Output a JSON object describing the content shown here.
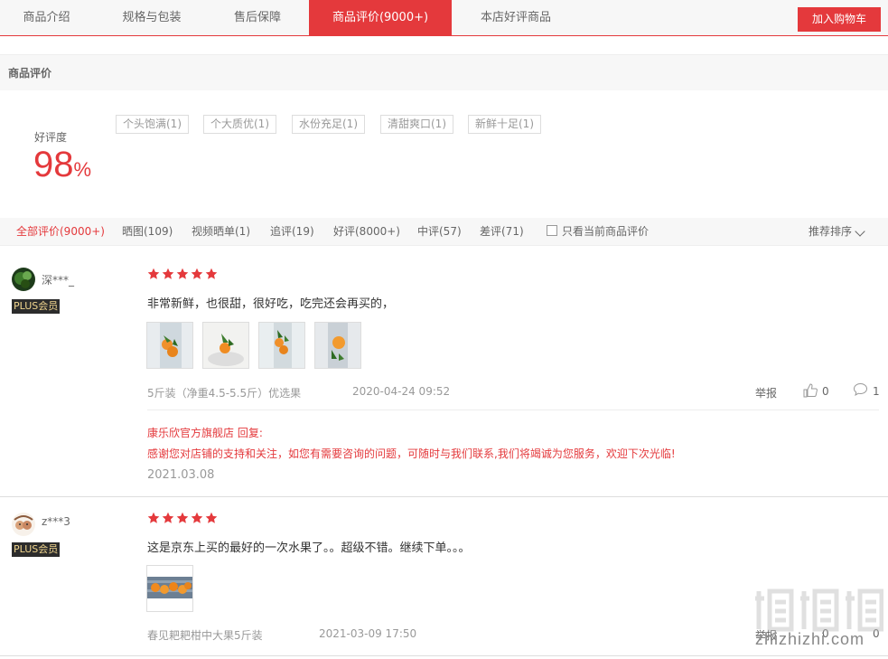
{
  "tabs": [
    {
      "label": "商品介绍",
      "active": false
    },
    {
      "label": "规格与包装",
      "active": false
    },
    {
      "label": "售后保障",
      "active": false
    },
    {
      "label": "商品评价(9000+)",
      "active": true
    },
    {
      "label": "本店好评商品",
      "active": false
    }
  ],
  "cart_button": "加入购物车",
  "section_title": "商品评价",
  "rating": {
    "label": "好评度",
    "value": "98",
    "unit": "%"
  },
  "tags": [
    "个头饱满(1)",
    "个大质优(1)",
    "水份充足(1)",
    "清甜爽口(1)",
    "新鲜十足(1)"
  ],
  "filters": [
    {
      "label": "全部评价(9000+)",
      "active": true
    },
    {
      "label": "晒图(109)",
      "active": false
    },
    {
      "label": "视频晒单(1)",
      "active": false
    },
    {
      "label": "追评(19)",
      "active": false
    },
    {
      "label": "好评(8000+)",
      "active": false
    },
    {
      "label": "中评(57)",
      "active": false
    },
    {
      "label": "差评(71)",
      "active": false
    }
  ],
  "only_current_label": "只看当前商品评价",
  "sort_label": "推荐排序",
  "reviews": [
    {
      "user": "深***_",
      "badge": "PLUS会员",
      "stars": 5,
      "text": "非常新鲜，也很甜，很好吃，吃完还会再买的，",
      "spec": "5斤装（净重4.5-5.5斤）优选果",
      "date": "2020-04-24 09:52",
      "report": "举报",
      "likes": "0",
      "comments": "1",
      "reply_title": "康乐欣官方旗舰店 回复:",
      "reply_text": "感谢您对店铺的支持和关注，如您有需要咨询的问题，可随时与我们联系,我们将竭诚为您服务，欢迎下次光临!",
      "reply_date": "2021.03.08"
    },
    {
      "user": "z***3",
      "badge": "PLUS会员",
      "stars": 5,
      "text": "这是京东上买的最好的一次水果了。。超级不错。继续下单。。。",
      "spec": "春见耙耙柑中大果5斤装",
      "date": "2021-03-09 17:50",
      "report": "举报",
      "likes": "0",
      "comments": "0"
    }
  ],
  "watermark": "zhizhizhi.com",
  "colors": {
    "accent": "#e4393c",
    "plus_bg": "#2c2c2c",
    "plus_text": "#f0d58e"
  }
}
